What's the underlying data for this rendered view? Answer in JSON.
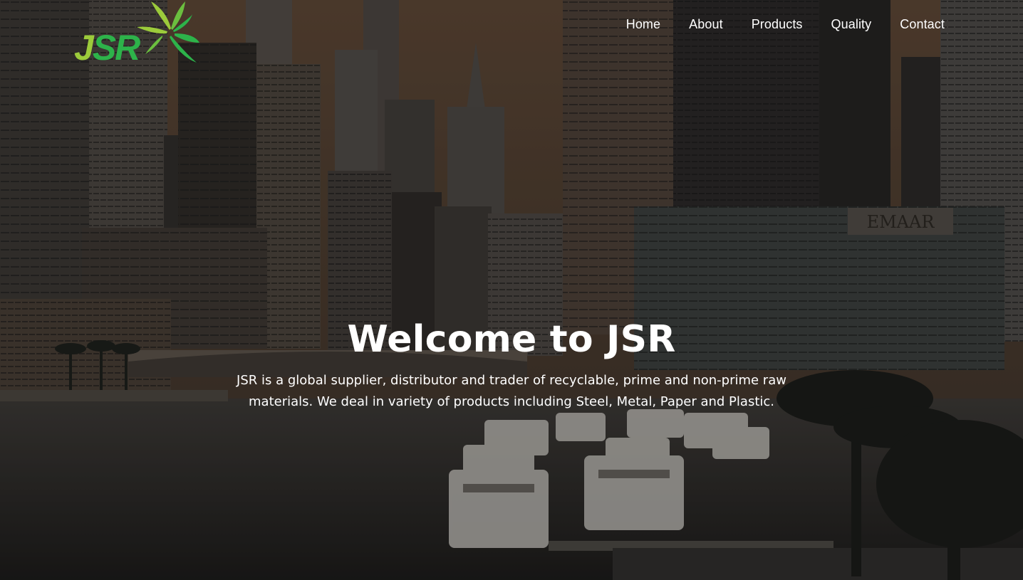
{
  "brand": {
    "logo_text": "JSR",
    "logo_green": "#2db34a",
    "logo_lime": "#9ccb3b"
  },
  "nav": {
    "items": [
      {
        "label": "Home"
      },
      {
        "label": "About"
      },
      {
        "label": "Products"
      },
      {
        "label": "Quality"
      },
      {
        "label": "Contact"
      }
    ]
  },
  "hero": {
    "title": "Welcome to JSR",
    "description": "JSR is a global supplier, distributor and trader of recyclable, prime and non-prime raw materials. We deal in variety of products including Steel, Metal, Paper and Plastic.",
    "background": "city-marina-skyline-image",
    "building_sign": "EMAAR"
  }
}
